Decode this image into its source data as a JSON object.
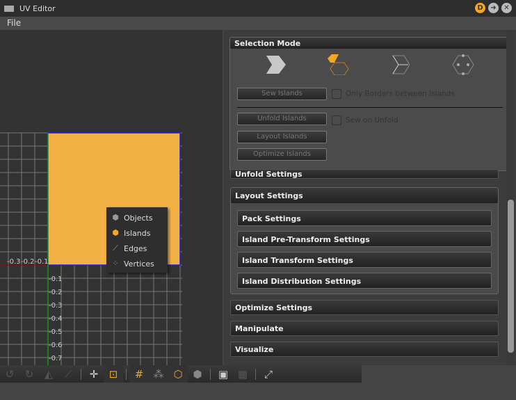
{
  "window": {
    "title": "UV Editor",
    "buttons": [
      "D",
      "➜",
      "✕"
    ]
  },
  "menu": {
    "file": "File"
  },
  "viewport": {
    "x_labels": [
      "-0.3",
      "-0.2",
      "-0.1"
    ],
    "y_labels": [
      "-0.1",
      "-0.2",
      "-0.3",
      "-0.4",
      "-0.5",
      "-0.6",
      "-0.7"
    ],
    "popup": [
      {
        "label": "Objects",
        "icon": "objects-icon"
      },
      {
        "label": "Islands",
        "icon": "islands-icon"
      },
      {
        "label": "Edges",
        "icon": "edges-icon"
      },
      {
        "label": "Vertices",
        "icon": "vertices-icon"
      }
    ]
  },
  "selection_mode": {
    "title": "Selection Mode",
    "modes": [
      "objects",
      "islands",
      "edges",
      "vertices"
    ],
    "active": "islands",
    "sew_islands": "Sew Islands",
    "only_borders": "Only Borders between Islands",
    "unfold_islands": "Unfold Islands",
    "sew_on_unfold": "Sew on Unfold",
    "layout_islands": "Layout Islands",
    "optimize_islands": "Optimize Islands"
  },
  "sections": {
    "unfold": "Unfold Settings",
    "layout": "Layout Settings",
    "pack": "Pack Settings",
    "pre_transform": "Island Pre-Transform Settings",
    "transform": "Island Transform Settings",
    "distribution": "Island Distribution Settings",
    "optimize": "Optimize Settings",
    "manipulate": "Manipulate",
    "visualize": "Visualize"
  },
  "colors": {
    "accent": "#f5a623",
    "uv_fill": "#f2b144",
    "uv_border": "#1a1aff"
  }
}
